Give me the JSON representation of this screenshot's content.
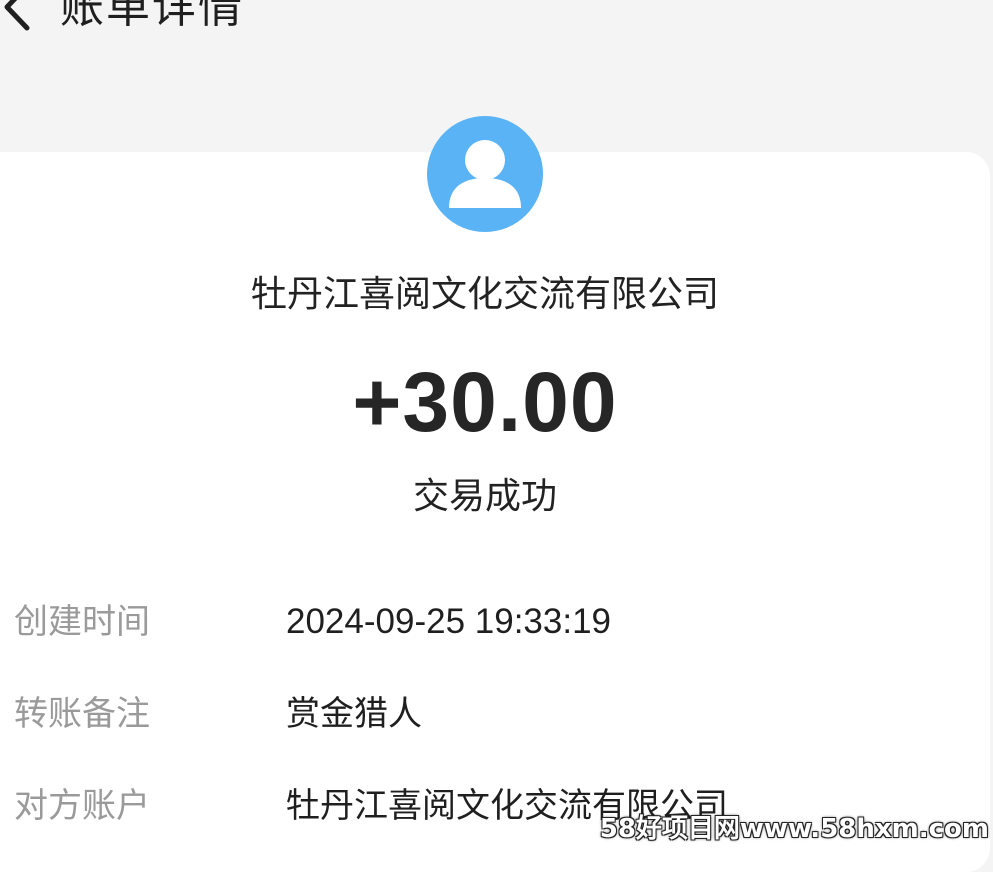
{
  "header": {
    "title": "账单详情",
    "back_icon": "chevron-left-icon"
  },
  "transaction": {
    "avatar_icon": "user-avatar-icon",
    "avatar_color": "#5ab3f5",
    "payer_name": "牡丹江喜阅文化交流有限公司",
    "amount": "+30.00",
    "status": "交易成功"
  },
  "details": [
    {
      "label": "创建时间",
      "value": "2024-09-25 19:33:19"
    },
    {
      "label": "转账备注",
      "value": "赏金猎人"
    },
    {
      "label": "对方账户",
      "value": "牡丹江喜阅文化交流有限公司"
    }
  ],
  "watermark": "58好项目网www.58hxm.com"
}
